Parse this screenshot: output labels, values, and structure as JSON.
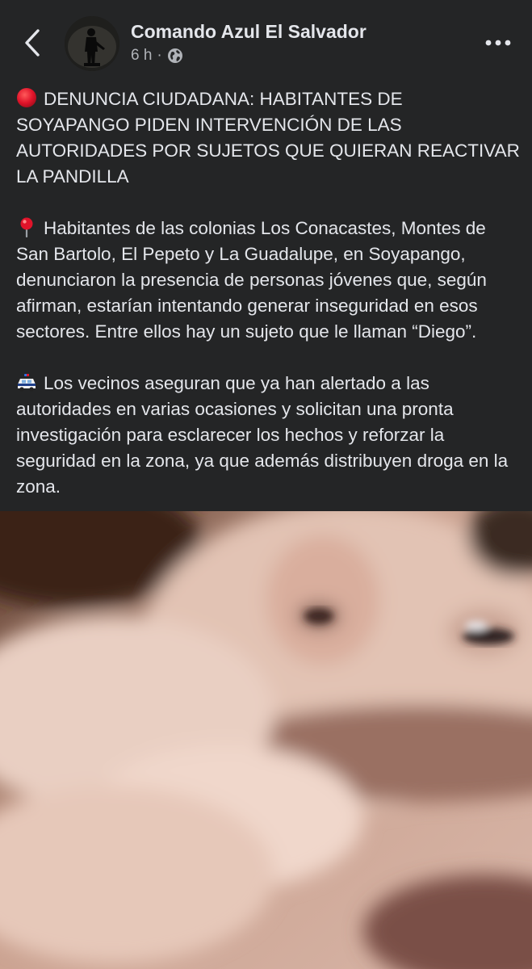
{
  "header": {
    "author_name": "Comando Azul  El Salvador",
    "timestamp": "6 h",
    "separator": "·",
    "audience_icon": "globe-icon",
    "back_icon": "chevron-left-icon",
    "more_icon": "ellipsis-icon",
    "avatar_icon": "soldier-silhouette"
  },
  "post": {
    "headline_emoji": "red-circle-icon",
    "headline": "DENUNCIA CIUDADANA: HABITANTES DE SOYAPANGO PIDEN INTERVENCIÓN DE LAS AUTORIDADES POR SUJETOS QUE QUIERAN REACTIVAR LA PANDILLA",
    "paragraph1_emoji": "round-pushpin-icon",
    "paragraph1": "Habitantes de las colonias Los Conacastes, Montes de San Bartolo, El Pepeto y La Guadalupe, en Soyapango, denunciaron la presencia de personas jóvenes que, según afirman, estarían intentando generar inseguridad en esos sectores. Entre ellos hay un sujeto que le llaman “Diego”.",
    "paragraph2_emoji": "police-car-icon",
    "paragraph2": "Los vecinos aseguran que ya han alertado a las autoridades en varias ocasiones y solicitan una pronta investigación para esclarecer los hechos y reforzar la seguridad en la zona, ya que además distribuyen droga en la zona."
  },
  "colors": {
    "background": "#242526",
    "primary_text": "#e4e6eb",
    "secondary_text": "#b0b3b8",
    "alert_red": "#e0142a"
  }
}
